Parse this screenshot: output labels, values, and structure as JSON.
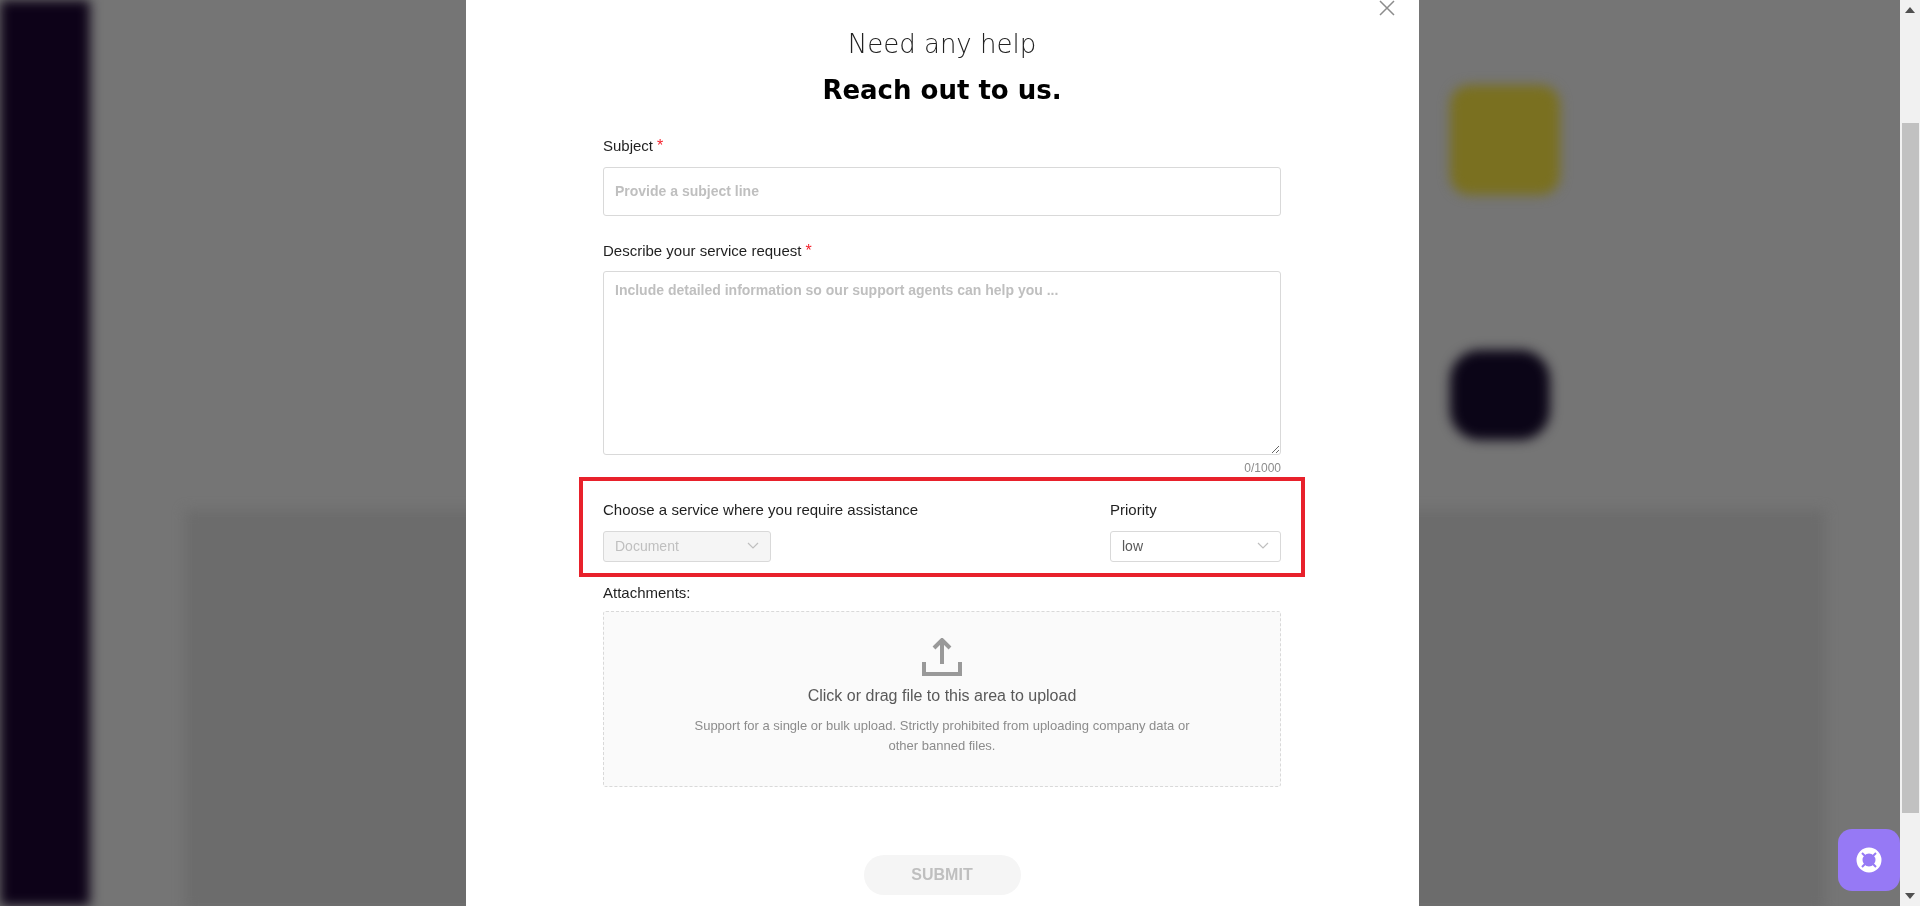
{
  "dialog": {
    "heading": "Need any help",
    "subheading": "Reach out to us.",
    "subject": {
      "label": "Subject",
      "required_mark": "*",
      "placeholder": "Provide a subject line"
    },
    "description": {
      "label": "Describe your service request",
      "required_mark": "*",
      "placeholder": "Include detailed information so our support agents can help you ...",
      "counter": "0/1000"
    },
    "service": {
      "label": "Choose a service where you require assistance",
      "value": "Document",
      "disabled": true
    },
    "priority": {
      "label": "Priority",
      "value": "low",
      "disabled": false
    },
    "attachments": {
      "label": "Attachments:",
      "title": "Click or drag file to this area to upload",
      "hint": "Support for a single or bulk upload. Strictly prohibited from uploading company data or other banned files."
    },
    "submit": {
      "label": "SUBMIT",
      "disabled": true
    }
  }
}
